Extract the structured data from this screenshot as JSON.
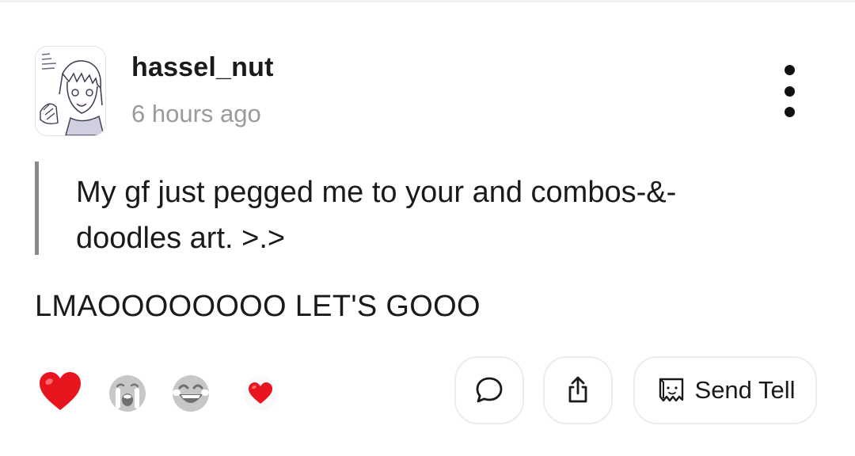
{
  "post": {
    "username": "hassel_nut",
    "timestamp": "6 hours ago",
    "quote": "My gf just pegged me to your and combos-&-doodles art. >.>",
    "message": "LMAOOOOOOOO LET'S GOOO",
    "avatar_icon": "anime-girl-avatar"
  },
  "reactions": [
    {
      "icon": "red-heart-icon",
      "state": "selected"
    },
    {
      "icon": "crying-face-icon",
      "state": "unselected"
    },
    {
      "icon": "laughing-face-icon",
      "state": "unselected"
    },
    {
      "icon": "small-heart-icon",
      "state": "unselected"
    }
  ],
  "actions": {
    "reply_icon": "speech-bubble-icon",
    "share_icon": "share-icon",
    "send_tell_label": "Send Tell",
    "send_tell_icon": "paper-bag-icon"
  },
  "colors": {
    "accent_heart": "#e8141e",
    "text": "#1a1a1a",
    "muted": "#9a9a9a",
    "quote_bar": "#8a8a8a",
    "border": "#ececec"
  }
}
